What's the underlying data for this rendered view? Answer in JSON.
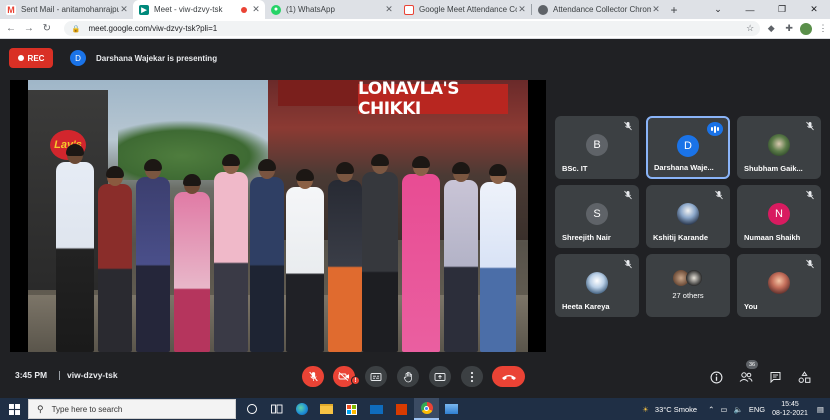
{
  "browser": {
    "tabs": [
      {
        "title": "Sent Mail - anitamohanrajput",
        "icon": "gmail-icon",
        "active": false
      },
      {
        "title": "Meet - viw-dzvy-tsk",
        "icon": "meet-icon",
        "active": true
      },
      {
        "title": "(1) WhatsApp",
        "icon": "whatsapp-icon",
        "active": false
      },
      {
        "title": "Google Meet Attendance Co",
        "icon": "attendance-icon",
        "active": false
      },
      {
        "title": "Attendance Collector Chrom",
        "icon": "chrome-webstore-icon",
        "active": false
      }
    ],
    "url": "meet.google.com/viw-dzvy-tsk?pli=1"
  },
  "meet": {
    "rec_label": "REC",
    "presenter_initial": "D",
    "presenter_text": "Darshana Wajekar is presenting",
    "shared_screen": {
      "sign_text": "LONAVLA'S CHIKKI",
      "brand_text": "Lay's"
    },
    "participants": [
      {
        "name": "BSc. IT",
        "initial": "B",
        "avatar_color": "#5f6368",
        "muted": true,
        "speaking": false
      },
      {
        "name": "Darshana Waje...",
        "initial": "D",
        "avatar_color": "#1a73e8",
        "muted": false,
        "speaking": true
      },
      {
        "name": "Shubham Gaik...",
        "initial": "",
        "avatar_color": "photo",
        "muted": true,
        "speaking": false
      },
      {
        "name": "Shreejith Nair",
        "initial": "S",
        "avatar_color": "#5f6368",
        "muted": true,
        "speaking": false
      },
      {
        "name": "Kshitij Karande",
        "initial": "",
        "avatar_color": "photo",
        "muted": true,
        "speaking": false
      },
      {
        "name": "Numaan Shaikh",
        "initial": "N",
        "avatar_color": "#d81b60",
        "muted": true,
        "speaking": false
      },
      {
        "name": "Heeta Kareya",
        "initial": "",
        "avatar_color": "photo",
        "muted": true,
        "speaking": false
      },
      {
        "name": "27 others",
        "initial": "",
        "avatar_color": "photo",
        "muted": false,
        "speaking": false
      },
      {
        "name": "You",
        "initial": "",
        "avatar_color": "photo",
        "muted": true,
        "speaking": false
      }
    ],
    "time": "3:45 PM",
    "meeting_code": "viw-dzvy-tsk",
    "people_count": "36",
    "camera_warning": "!"
  },
  "taskbar": {
    "search_placeholder": "Type here to search",
    "weather": "33°C  Smoke",
    "language": "ENG",
    "time": "15:45",
    "date": "08-12-2021"
  },
  "colors": {
    "meet_bg": "#202124",
    "tile_bg": "#3c4043",
    "danger": "#ea4335",
    "accent": "#1a73e8",
    "taskbar": "#1f2f45"
  }
}
